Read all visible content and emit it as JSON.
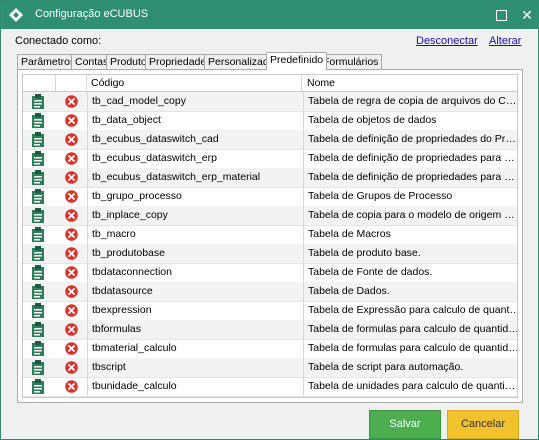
{
  "window": {
    "title": "Configuração eCUBUS",
    "app_icon": "ecubus-logo-icon"
  },
  "titlebar_buttons": {
    "maximize_icon": "maximize-icon",
    "close_label": "✕"
  },
  "header": {
    "connected_label": "Conectado como:",
    "disconnect_label": "Desconectar",
    "change_label": "Alterar"
  },
  "tabs": [
    {
      "label": "Parâmetros",
      "active": false
    },
    {
      "label": "Contas",
      "active": false
    },
    {
      "label": "Produto",
      "active": false
    },
    {
      "label": "Propriedades",
      "active": false
    },
    {
      "label": "Personalizado",
      "active": false
    },
    {
      "label": "Predefinido",
      "active": true
    },
    {
      "label": "Formulários",
      "active": false
    }
  ],
  "grid": {
    "columns": {
      "codigo": "Código",
      "nome": "Nome"
    },
    "row_icons": {
      "edit": "clipboard-icon",
      "delete": "delete-icon"
    },
    "rows": [
      {
        "codigo": "tb_cad_model_copy",
        "nome": "Tabela de regra de copia de arquivos do CAD."
      },
      {
        "codigo": "tb_data_object",
        "nome": "Tabela de objetos de dados"
      },
      {
        "codigo": "tb_ecubus_dataswitch_cad",
        "nome": "Tabela de definição de propriedades do Produto para..."
      },
      {
        "codigo": "tb_ecubus_dataswitch_erp",
        "nome": "Tabela de definição de propriedades para Comutar d..."
      },
      {
        "codigo": "tb_ecubus_dataswitch_erp_material",
        "nome": "Tabela de definição de propriedades para Comutar d..."
      },
      {
        "codigo": "tb_grupo_processo",
        "nome": "Tabela de Grupos de Processo"
      },
      {
        "codigo": "tb_inplace_copy",
        "nome": "Tabela de copia para o modelo de origem pelo modo ..."
      },
      {
        "codigo": "tb_macro",
        "nome": "Tabela de Macros"
      },
      {
        "codigo": "tb_produtobase",
        "nome": "Tabela de produto base."
      },
      {
        "codigo": "tbdataconnection",
        "nome": "Tabela de Fonte de dados."
      },
      {
        "codigo": "tbdatasource",
        "nome": "Tabela de Dados."
      },
      {
        "codigo": "tbexpression",
        "nome": "Tabela de Expressão para calculo de quantidade bruta."
      },
      {
        "codigo": "tbformulas",
        "nome": "Tabela de formulas para calculo de quantidade bruta."
      },
      {
        "codigo": "tbmaterial_calculo",
        "nome": "Tabela de formulas para calculo de quantidade bruta..."
      },
      {
        "codigo": "tbscript",
        "nome": "Tabela de script para automação."
      },
      {
        "codigo": "tbunidade_calculo",
        "nome": "Tabela de unidades para calculo de quantidade bruta..."
      }
    ]
  },
  "buttons": {
    "save": "Salvar",
    "cancel": "Cancelar"
  },
  "colors": {
    "titlebar": "#2f8f72",
    "save": "#4cae4f",
    "cancel": "#f2c12e",
    "delete": "#d9342b",
    "clipboard": "#2e7d5b"
  }
}
